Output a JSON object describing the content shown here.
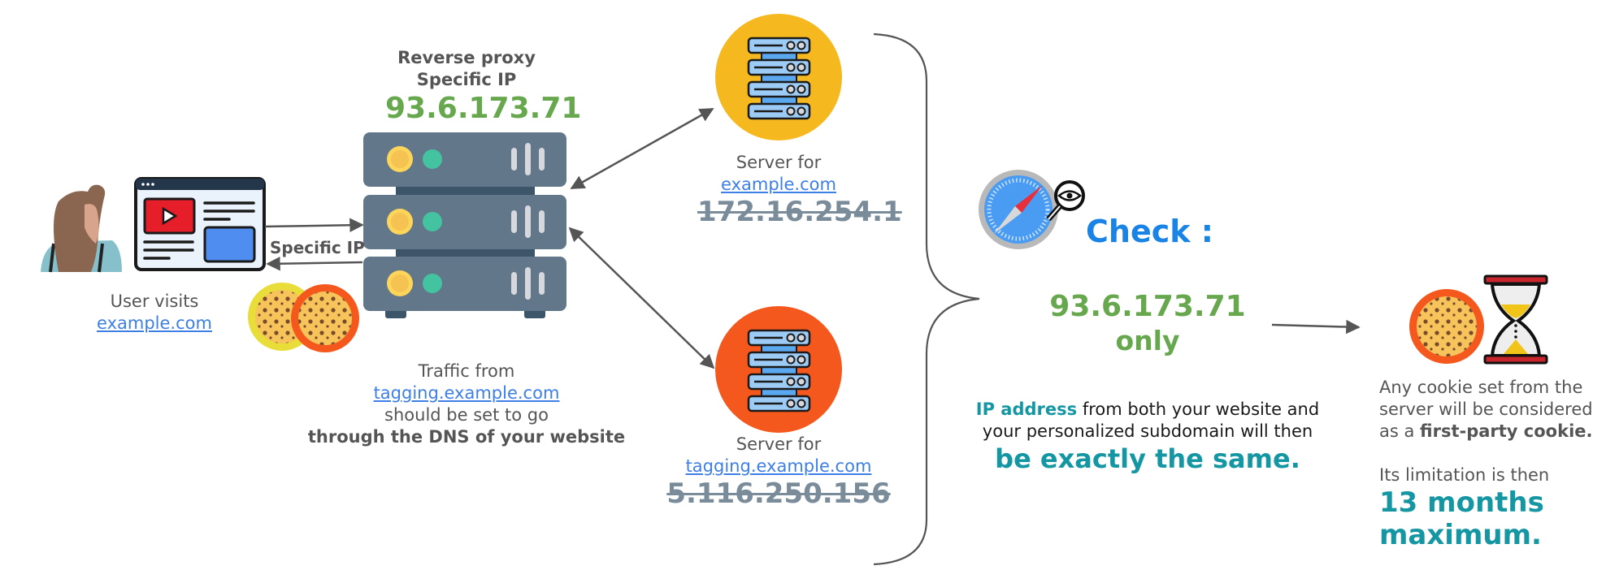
{
  "user": {
    "caption_line1": "User visits",
    "caption_link": "example.com"
  },
  "connection": {
    "label": "Specific IP"
  },
  "proxy": {
    "title_line1": "Reverse proxy",
    "title_line2": "Specific IP",
    "ip": "93.6.173.71"
  },
  "traffic_note": {
    "line1": "Traffic from",
    "link": "tagging.example.com",
    "line3": "should be set to go",
    "line4_bold": "through the DNS of your website"
  },
  "server_main": {
    "caption_line1": "Server for",
    "caption_link": "example.com",
    "ip_struck": "172.16.254.1",
    "color": "#f5b81e"
  },
  "server_tagging": {
    "caption_line1": "Server for",
    "caption_link": "tagging.example.com",
    "ip_struck": "5.116.250.156",
    "color": "#f4581c"
  },
  "check": {
    "title": "Check :",
    "ip": "93.6.173.71",
    "qualifier": "only",
    "explain_bold": "IP address",
    "explain_rest1": " from both your website and",
    "explain_line2": "your personalized subdomain will then",
    "explain_emphasis": "be exactly the same."
  },
  "result": {
    "line1": "Any cookie set from the",
    "line2": "server will be considered",
    "line3_prefix": "as a ",
    "line3_bold": "first-party cookie.",
    "limit_line": "Its limitation is then",
    "limit_value_line1": "13 months",
    "limit_value_line2": "maximum."
  },
  "colors": {
    "green": "#67a84e",
    "teal": "#1597a3",
    "blue": "#1a84e6",
    "server_body": "#627789",
    "link": "#3d7fe6"
  }
}
